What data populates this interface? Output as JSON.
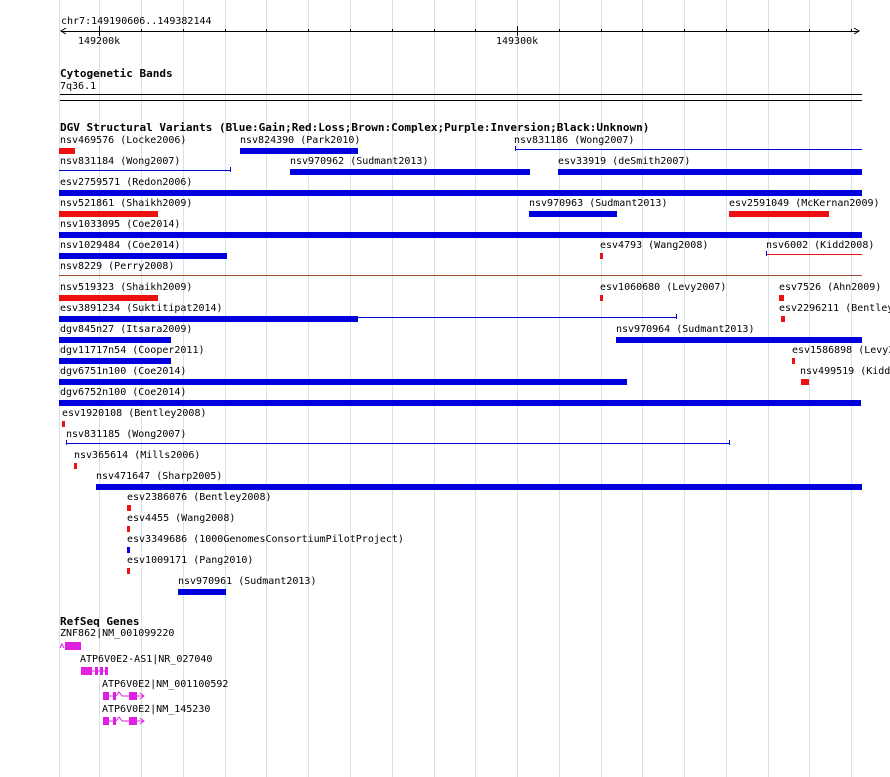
{
  "ruler": {
    "region_label": "chr7:149190606..149382144",
    "tick_labels": [
      "149200k",
      "149300k"
    ]
  },
  "cytoband": {
    "title": "Cytogenetic Bands",
    "band_label": "7q36.1"
  },
  "dgv": {
    "title": "DGV Structural Variants (Blue:Gain;Red:Loss;Brown:Complex;Purple:Inversion;Black:Unknown)",
    "colors": {
      "gain": "#0000dd",
      "loss": "#ee1111",
      "complex": "#a0522d",
      "inversion": "#800080",
      "unknown": "#000000"
    },
    "features": [
      {
        "label": "nsv469576 (Locke2006)",
        "type": "loss"
      },
      {
        "label": "nsv824390 (Park2010)",
        "type": "gain"
      },
      {
        "label": "nsv831186 (Wong2007)",
        "type": "gain"
      },
      {
        "label": "nsv831184 (Wong2007)",
        "type": "gain"
      },
      {
        "label": "nsv970962 (Sudmant2013)",
        "type": "gain"
      },
      {
        "label": "esv33919 (deSmith2007)",
        "type": "gain"
      },
      {
        "label": "esv2759571 (Redon2006)",
        "type": "gain"
      },
      {
        "label": "nsv521861 (Shaikh2009)",
        "type": "loss"
      },
      {
        "label": "nsv970963 (Sudmant2013)",
        "type": "gain"
      },
      {
        "label": "esv2591049 (McKernan2009)",
        "type": "loss"
      },
      {
        "label": "nsv1033095 (Coe2014)",
        "type": "gain"
      },
      {
        "label": "nsv1029484 (Coe2014)",
        "type": "gain"
      },
      {
        "label": "esv4793 (Wang2008)",
        "type": "loss"
      },
      {
        "label": "nsv6002 (Kidd2008)",
        "type": "loss"
      },
      {
        "label": "nsv8229 (Perry2008)",
        "type": "complex"
      },
      {
        "label": "nsv519323 (Shaikh2009)",
        "type": "loss"
      },
      {
        "label": "esv1060680 (Levy2007)",
        "type": "loss"
      },
      {
        "label": "esv7526 (Ahn2009)",
        "type": "loss"
      },
      {
        "label": "esv3891234 (Suktitipat2014)",
        "type": "gain"
      },
      {
        "label": "esv2296211 (Bentley",
        "type": "loss"
      },
      {
        "label": "dgv845n27 (Itsara2009)",
        "type": "gain"
      },
      {
        "label": "nsv970964 (Sudmant2013)",
        "type": "gain"
      },
      {
        "label": "dgv11717n54 (Cooper2011)",
        "type": "gain"
      },
      {
        "label": "esv1586898 (Levy2",
        "type": "loss"
      },
      {
        "label": "dgv6751n100 (Coe2014)",
        "type": "gain"
      },
      {
        "label": "nsv499519 (Kidd",
        "type": "loss"
      },
      {
        "label": "dgv6752n100 (Coe2014)",
        "type": "gain"
      },
      {
        "label": "esv1920108 (Bentley2008)",
        "type": "loss"
      },
      {
        "label": "nsv831185 (Wong2007)",
        "type": "gain"
      },
      {
        "label": "nsv365614 (Mills2006)",
        "type": "loss"
      },
      {
        "label": "nsv471647 (Sharp2005)",
        "type": "gain"
      },
      {
        "label": "esv2386076 (Bentley2008)",
        "type": "loss"
      },
      {
        "label": "esv4455 (Wang2008)",
        "type": "loss"
      },
      {
        "label": "esv3349686 (1000GenomesConsortiumPilotProject)",
        "type": "gain"
      },
      {
        "label": "esv1009171 (Pang2010)",
        "type": "loss"
      },
      {
        "label": "nsv970961 (Sudmant2013)",
        "type": "gain"
      }
    ]
  },
  "refseq": {
    "title": "RefSeq Genes",
    "color": "#e020e0",
    "genes": [
      {
        "label": "ZNF862|NM_001099220"
      },
      {
        "label": "ATP6V0E2-AS1|NR_027040"
      },
      {
        "label": "ATP6V0E2|NM_001100592"
      },
      {
        "label": "ATP6V0E2|NM_145230"
      }
    ]
  }
}
